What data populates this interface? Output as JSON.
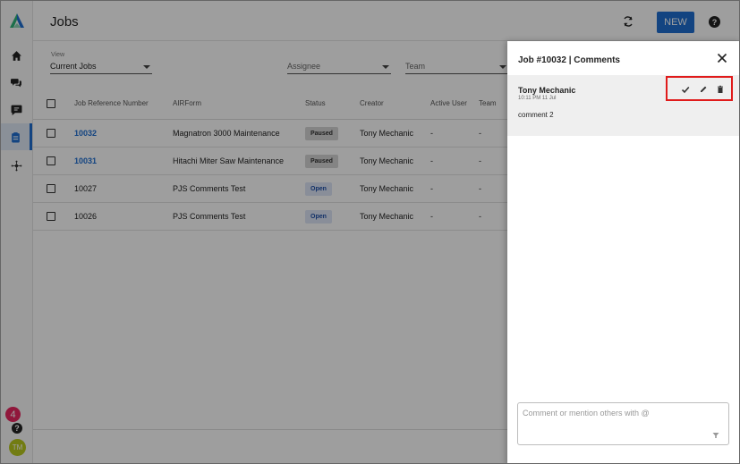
{
  "app": {
    "title": "Jobs"
  },
  "header": {
    "new_label": "NEW",
    "help_label": "?"
  },
  "sidebar": {
    "items": [
      {
        "icon": "home-icon"
      },
      {
        "icon": "chat-bubbles-icon"
      },
      {
        "icon": "message-icon"
      },
      {
        "icon": "clipboard-icon",
        "active": true
      },
      {
        "icon": "network-icon"
      }
    ],
    "notification_count": "4",
    "help_label": "?",
    "avatar_initials": "TM"
  },
  "filters": {
    "view_label": "View",
    "view_value": "Current Jobs",
    "assignee_placeholder": "Assignee",
    "team_placeholder": "Team"
  },
  "table": {
    "columns": [
      "Job Reference Number",
      "AIRForm",
      "Status",
      "Creator",
      "Active User",
      "Team"
    ],
    "rows": [
      {
        "ref": "10032",
        "form": "Magnatron 3000 Maintenance",
        "status": "Paused",
        "creator": "Tony Mechanic",
        "active_user": "-",
        "team": "-",
        "linked": true
      },
      {
        "ref": "10031",
        "form": "Hitachi Miter Saw Maintenance",
        "status": "Paused",
        "creator": "Tony Mechanic",
        "active_user": "-",
        "team": "-",
        "linked": true
      },
      {
        "ref": "10027",
        "form": "PJS Comments Test",
        "status": "Open",
        "creator": "Tony Mechanic",
        "active_user": "-",
        "team": "-",
        "linked": false
      },
      {
        "ref": "10026",
        "form": "PJS Comments Test",
        "status": "Open",
        "creator": "Tony Mechanic",
        "active_user": "-",
        "team": "-",
        "linked": false
      }
    ]
  },
  "panel": {
    "title": "Job #10032 | Comments",
    "comment": {
      "author": "Tony Mechanic",
      "time": "10:11 PM 11 Jul",
      "text": "comment 2"
    },
    "input_placeholder": "Comment or mention others with @"
  },
  "colors": {
    "accent": "#1f6fd1",
    "highlight": "#e01b1b",
    "badge": "#e8265f",
    "avatar": "#b9c81e"
  }
}
